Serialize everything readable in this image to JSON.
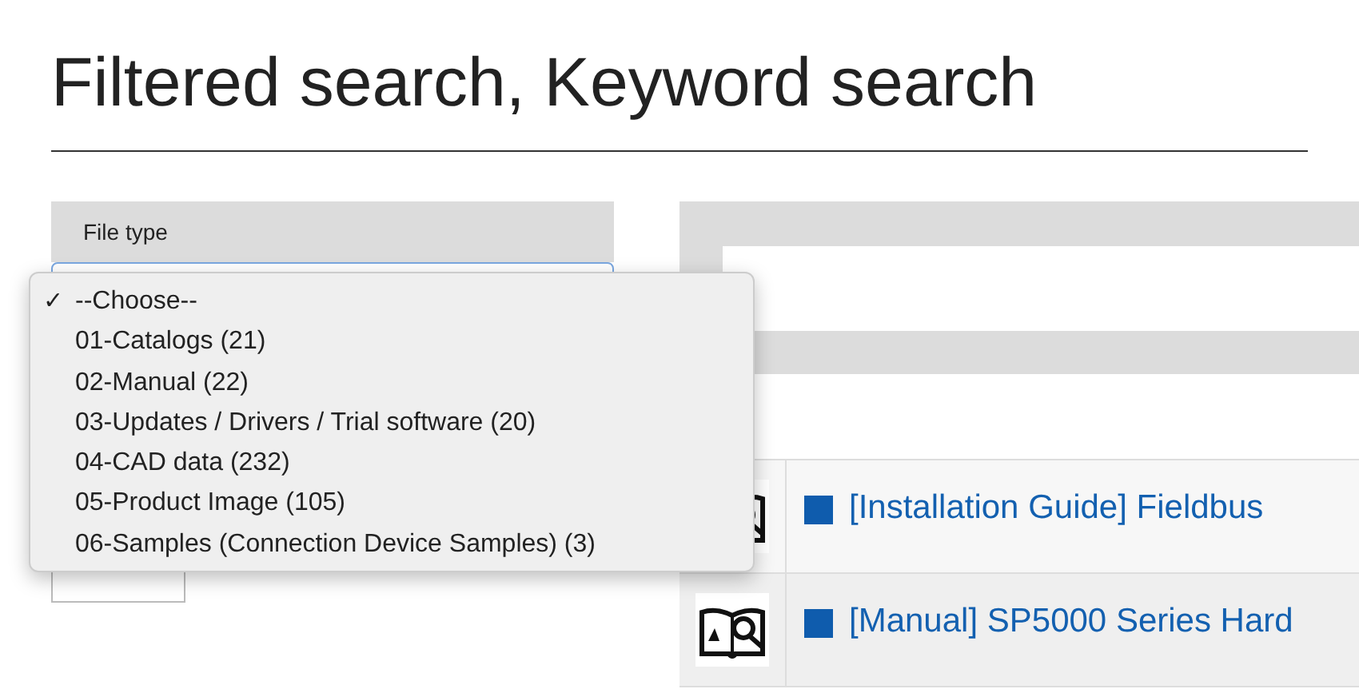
{
  "page_title": "Filtered search, Keyword search",
  "filter": {
    "label": "File type"
  },
  "check_glyph": "✓",
  "dropdown_options": [
    {
      "label": "--Choose--",
      "selected": true
    },
    {
      "label": "01-Catalogs (21)",
      "selected": false
    },
    {
      "label": "02-Manual (22)",
      "selected": false
    },
    {
      "label": "03-Updates / Drivers / Trial software (20)",
      "selected": false
    },
    {
      "label": "04-CAD data (232)",
      "selected": false
    },
    {
      "label": "05-Product Image (105)",
      "selected": false
    },
    {
      "label": "06-Samples (Connection Device Samples) (3)",
      "selected": false
    }
  ],
  "results": [
    {
      "title": "[Installation Guide] Fieldbus"
    },
    {
      "title": "[Manual] SP5000 Series Hard"
    }
  ]
}
